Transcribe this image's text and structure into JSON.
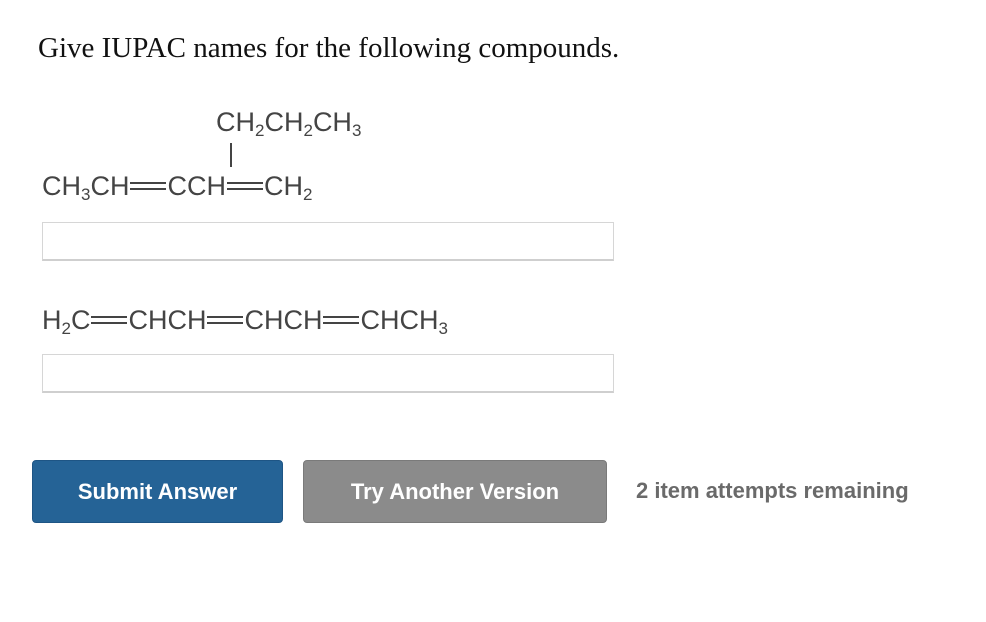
{
  "question": "Give IUPAC names for the following compounds.",
  "compound1": {
    "branch": [
      "CH",
      "2",
      "CH",
      "2",
      "CH",
      "3"
    ],
    "main": [
      "CH",
      "3",
      "CH",
      "CCH",
      "CH",
      "2"
    ]
  },
  "compound2": {
    "parts": [
      "H",
      "2",
      "C",
      "CHCH",
      "CHCH",
      "CHCH",
      "3"
    ]
  },
  "answers": {
    "field1_value": "",
    "field2_value": ""
  },
  "buttons": {
    "submit": "Submit Answer",
    "try_another": "Try Another Version"
  },
  "status": {
    "attempts": "2 item attempts remaining"
  },
  "colors": {
    "submit_bg": "#256396",
    "try_bg": "#8b8b8b",
    "attempts_text": "#6a6a6a"
  }
}
